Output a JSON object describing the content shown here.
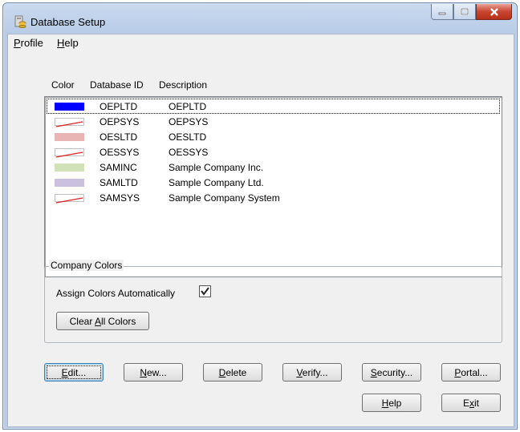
{
  "window": {
    "title": "Database Setup",
    "accent_color": "#b7cbe6"
  },
  "menu": [
    {
      "label_underlined": "P",
      "label_rest": "rofile"
    },
    {
      "label_underlined": "H",
      "label_rest": "elp"
    }
  ],
  "list": {
    "headers": [
      "Color",
      "Database ID",
      "Description"
    ],
    "rows": [
      {
        "color": "#0000ff",
        "id": "OEPLTD",
        "description": "OEPLTD",
        "focused": true
      },
      {
        "color": "none",
        "id": "OEPSYS",
        "description": "OEPSYS"
      },
      {
        "color": "#e8b4b4",
        "id": "OESLTD",
        "description": "OESLTD"
      },
      {
        "color": "none",
        "id": "OESSYS",
        "description": "OESSYS"
      },
      {
        "color": "#d2e2b8",
        "id": "SAMINC",
        "description": "Sample Company Inc."
      },
      {
        "color": "#cbc0de",
        "id": "SAMLTD",
        "description": "Sample Company Ltd."
      },
      {
        "color": "none",
        "id": "SAMSYS",
        "description": "Sample Company System"
      }
    ]
  },
  "company_colors": {
    "group_title": "Company Colors",
    "auto_label": "Assign Colors Automatically",
    "auto_checked": true,
    "clear_pre": "Clear ",
    "clear_u": "A",
    "clear_post": "ll Colors"
  },
  "buttons": {
    "edit": {
      "u": "E",
      "rest": "dit..."
    },
    "new": {
      "u": "N",
      "rest": "ew..."
    },
    "delete": {
      "u": "D",
      "rest": "elete"
    },
    "verify": {
      "u": "V",
      "rest": "erify..."
    },
    "security": {
      "u": "S",
      "rest": "ecurity..."
    },
    "portal": {
      "u": "P",
      "rest": "ortal..."
    },
    "help": {
      "u": "H",
      "rest": "elp"
    },
    "exit_pre": "E",
    "exit_u": "x",
    "exit_post": "it"
  }
}
